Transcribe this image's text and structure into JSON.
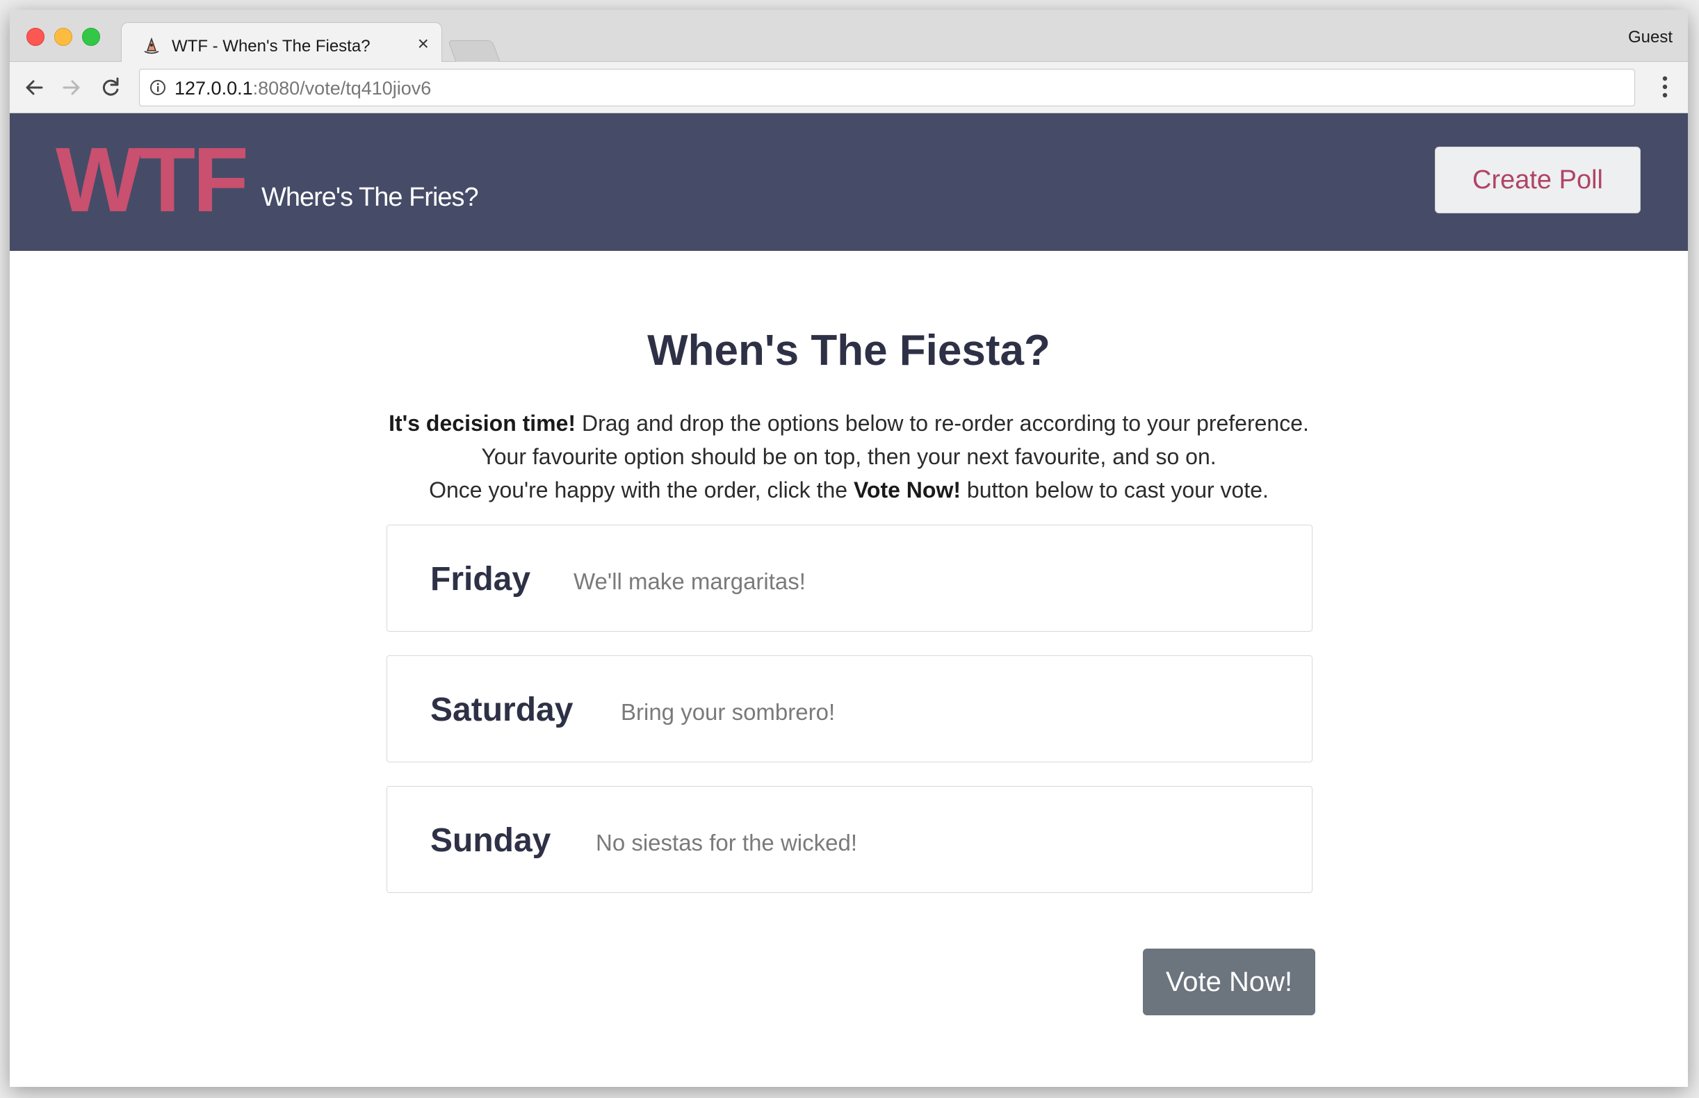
{
  "browser": {
    "tab": {
      "title": "WTF - When's The Fiesta?",
      "close_glyph": "×"
    },
    "profile_label": "Guest",
    "address_bar": {
      "host": "127.0.0.1",
      "rest": ":8080/vote/tq410jiov6"
    },
    "icons": {
      "back": "back-arrow-icon",
      "forward": "forward-arrow-icon",
      "reload": "reload-icon",
      "info": "info-icon",
      "menu": "vertical-dots-menu-icon",
      "favicon": "sombrero-favicon-icon"
    }
  },
  "header": {
    "logo": "WTF",
    "tagline": "Where's The Fries?",
    "create_poll_label": "Create Poll"
  },
  "poll": {
    "title": "When's The Fiesta?",
    "instructions": {
      "line1_bold": "It's decision time!",
      "line1_rest": " Drag and drop the options below to re-order according to your preference.",
      "line2": "Your favourite option should be on top, then your next favourite, and so on.",
      "line3_start": "Once you're happy with the order, click the ",
      "line3_bold": "Vote Now!",
      "line3_end": " button below to cast your vote."
    },
    "options": [
      {
        "day": "Friday",
        "note": "We'll make margaritas!"
      },
      {
        "day": "Saturday",
        "note": "Bring your sombrero!"
      },
      {
        "day": "Sunday",
        "note": "No siestas for the wicked!"
      }
    ],
    "vote_button_label": "Vote Now!"
  },
  "colors": {
    "header_bg": "#464c67",
    "logo": "#c9506f",
    "create_poll_text": "#b04464",
    "vote_button_bg": "#6c747e",
    "title_text": "#2e3146"
  }
}
